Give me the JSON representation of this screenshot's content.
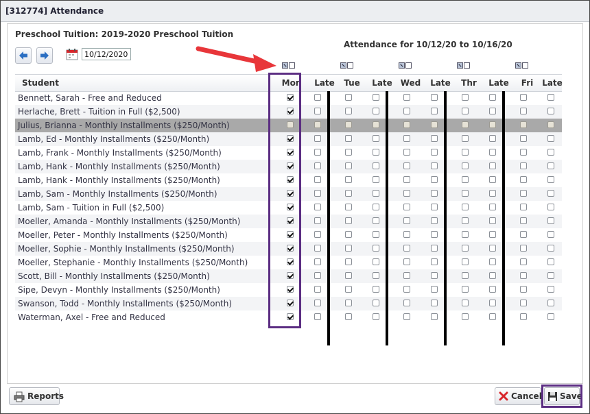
{
  "window": {
    "title": "[312774] Attendance"
  },
  "course": {
    "title": "Preschool Tuition: 2019-2020 Preschool Tuition"
  },
  "attendance": {
    "range_label": "Attendance for 10/12/20 to 10/16/20"
  },
  "date": {
    "value": "10/12/2020"
  },
  "columns": {
    "student": "Student",
    "days": [
      {
        "day": "Mon",
        "late": "Late"
      },
      {
        "day": "Tue",
        "late": "Late"
      },
      {
        "day": "Wed",
        "late": "Late"
      },
      {
        "day": "Thr",
        "late": "Late"
      },
      {
        "day": "Fri",
        "late": "Late"
      }
    ]
  },
  "students": [
    {
      "name": "Bennett, Sarah - Free and Reduced",
      "mon": true,
      "disabled": false
    },
    {
      "name": "Herlache, Brett - Tuition in Full ($2,500)",
      "mon": true,
      "disabled": false
    },
    {
      "name": "Julius, Brianna - Monthly Installments ($250/Month)",
      "mon": false,
      "disabled": true
    },
    {
      "name": "Lamb, Ed - Monthly Installments ($250/Month)",
      "mon": true,
      "disabled": false
    },
    {
      "name": "Lamb, Frank - Monthly Installments ($250/Month)",
      "mon": true,
      "disabled": false
    },
    {
      "name": "Lamb, Hank - Monthly Installments ($250/Month)",
      "mon": true,
      "disabled": false
    },
    {
      "name": "Lamb, Hank - Monthly Installments ($250/Month)",
      "mon": true,
      "disabled": false
    },
    {
      "name": "Lamb, Sam - Monthly Installments ($250/Month)",
      "mon": true,
      "disabled": false
    },
    {
      "name": "Lamb, Sam - Tuition in Full ($2,500)",
      "mon": true,
      "disabled": false
    },
    {
      "name": "Moeller, Amanda - Monthly Installments ($250/Month)",
      "mon": true,
      "disabled": false
    },
    {
      "name": "Moeller, Peter - Monthly Installments ($250/Month)",
      "mon": true,
      "disabled": false
    },
    {
      "name": "Moeller, Sophie - Monthly Installments ($250/Month)",
      "mon": true,
      "disabled": false
    },
    {
      "name": "Moeller, Stephanie - Monthly Installments ($250/Month)",
      "mon": true,
      "disabled": false
    },
    {
      "name": "Scott, Bill - Monthly Installments ($250/Month)",
      "mon": true,
      "disabled": false
    },
    {
      "name": "Sipe, Devyn - Monthly Installments ($250/Month)",
      "mon": true,
      "disabled": false
    },
    {
      "name": "Swanson, Todd - Monthly Installments ($250/Month)",
      "mon": true,
      "disabled": false
    },
    {
      "name": "Waterman, Axel - Free and Reduced",
      "mon": true,
      "disabled": false
    }
  ],
  "toggles": [
    {
      "day": "Mon",
      "checked_state": true
    },
    {
      "day": "Tue",
      "checked_state": true
    },
    {
      "day": "Wed",
      "checked_state": true
    },
    {
      "day": "Thr",
      "checked_state": true
    },
    {
      "day": "Fri",
      "checked_state": true
    }
  ],
  "buttons": {
    "reports": "Reports",
    "cancel": "Cancel",
    "save": "Save"
  },
  "colors": {
    "highlight": "#5b2d82",
    "arrow": "#e8363a",
    "cancel_icon": "#d8262b",
    "nav_arrow": "#2b6fc2"
  },
  "icons": {
    "prev": "left-arrow-icon",
    "next": "right-arrow-icon",
    "calendar": "calendar-icon",
    "reports": "printer-icon",
    "cancel": "x-icon",
    "save": "floppy-disk-icon"
  }
}
